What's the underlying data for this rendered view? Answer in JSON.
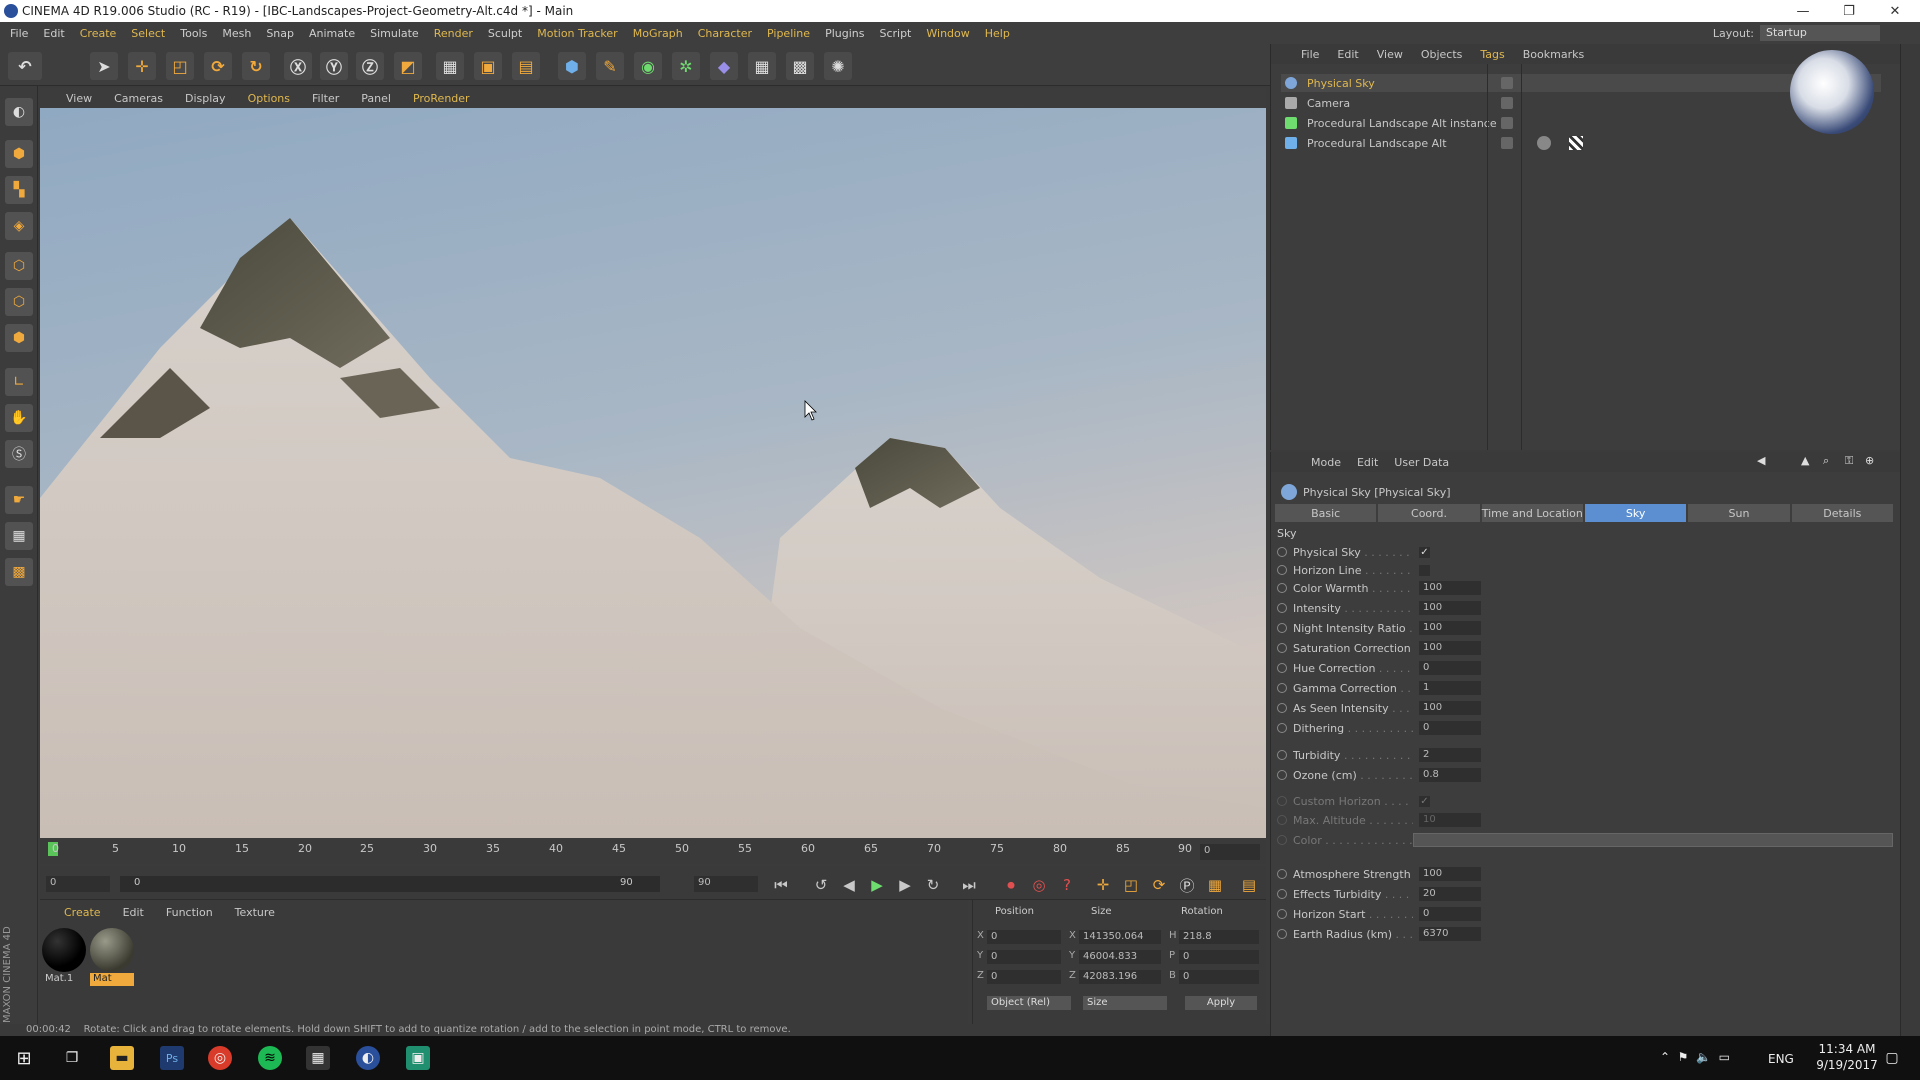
{
  "window": {
    "title": "CINEMA 4D R19.006 Studio (RC - R19) - [IBC-Landscapes-Project-Geometry-Alt.c4d *] - Main",
    "controls": {
      "minimize": "—",
      "maximize": "❐",
      "close": "✕"
    }
  },
  "menu": [
    "File",
    "Edit",
    "Create",
    "Select",
    "Tools",
    "Mesh",
    "Snap",
    "Animate",
    "Simulate",
    "Render",
    "Sculpt",
    "Motion Tracker",
    "MoGraph",
    "Character",
    "Pipeline",
    "Plugins",
    "Script",
    "Window",
    "Help"
  ],
  "layout": {
    "label": "Layout:",
    "value": "Startup"
  },
  "viewport_menu": [
    "View",
    "Cameras",
    "Display",
    "Options",
    "Filter",
    "Panel",
    "ProRender"
  ],
  "timeline": {
    "ticks": [
      "0",
      "5",
      "10",
      "15",
      "20",
      "25",
      "30",
      "35",
      "40",
      "45",
      "50",
      "55",
      "60",
      "65",
      "70",
      "75",
      "80",
      "85",
      "90"
    ],
    "current": "0",
    "start": "0",
    "range_start": "0",
    "range_end": "90",
    "end": "90"
  },
  "material_menu": [
    "Create",
    "Edit",
    "Function",
    "Texture"
  ],
  "materials": [
    {
      "name": "Mat.1",
      "selected": false
    },
    {
      "name": "Mat",
      "selected": true
    }
  ],
  "coords": {
    "headers": {
      "position": "Position",
      "size": "Size",
      "rotation": "Rotation"
    },
    "rows": [
      {
        "axis": "X",
        "pos": "0",
        "size_axis": "X",
        "size": "141350.064",
        "rot_axis": "H",
        "rot": "218.8"
      },
      {
        "axis": "Y",
        "pos": "0",
        "size_axis": "Y",
        "size": "46004.833",
        "rot_axis": "P",
        "rot": "0"
      },
      {
        "axis": "Z",
        "pos": "0",
        "size_axis": "Z",
        "size": "42083.196",
        "rot_axis": "B",
        "rot": "0"
      }
    ],
    "mode": "Object (Rel)",
    "size_mode": "Size",
    "apply": "Apply"
  },
  "status": {
    "time": "00:00:42",
    "message": "Rotate: Click and drag to rotate elements. Hold down SHIFT to add to quantize rotation / add to the selection in point mode, CTRL to remove."
  },
  "objects_menu": [
    "File",
    "Edit",
    "View",
    "Objects",
    "Tags",
    "Bookmarks"
  ],
  "objects": [
    {
      "name": "Physical Sky",
      "selected": true
    },
    {
      "name": "Camera",
      "selected": false
    },
    {
      "name": "Procedural Landscape Alt instance",
      "selected": false
    },
    {
      "name": "Procedural Landscape Alt",
      "selected": false
    }
  ],
  "attributes_menu": [
    "Mode",
    "Edit",
    "User Data"
  ],
  "attributes_title": "Physical Sky [Physical Sky]",
  "tabs": [
    "Basic",
    "Coord.",
    "Time and Location",
    "Sky",
    "Sun",
    "Details"
  ],
  "active_tab": "Sky",
  "section": "Sky",
  "params": [
    {
      "label": "Physical Sky",
      "type": "check",
      "value": "✓"
    },
    {
      "label": "Horizon Line",
      "type": "check",
      "value": ""
    },
    {
      "label": "Color Warmth",
      "type": "num",
      "value": "100"
    },
    {
      "label": "Intensity",
      "type": "num",
      "value": "100"
    },
    {
      "label": "Night Intensity Ratio",
      "type": "num",
      "value": "100"
    },
    {
      "label": "Saturation Correction",
      "type": "num",
      "value": "100"
    },
    {
      "label": "Hue Correction",
      "type": "num",
      "value": "0"
    },
    {
      "label": "Gamma Correction",
      "type": "num",
      "value": "1"
    },
    {
      "label": "As Seen Intensity",
      "type": "num",
      "value": "100"
    },
    {
      "label": "Dithering",
      "type": "num",
      "value": "0"
    },
    {
      "label": "Turbidity",
      "type": "num",
      "value": "2"
    },
    {
      "label": "Ozone (cm)",
      "type": "num",
      "value": "0.8"
    },
    {
      "label": "Custom Horizon",
      "type": "check",
      "value": "✓",
      "disabled": true
    },
    {
      "label": "Max. Altitude",
      "type": "num",
      "value": "10",
      "disabled": true
    },
    {
      "label": "Color",
      "type": "gradient",
      "value": "",
      "disabled": true
    },
    {
      "label": "Atmosphere Strength",
      "type": "num",
      "value": "100"
    },
    {
      "label": "Effects Turbidity",
      "type": "num",
      "value": "20"
    },
    {
      "label": "Horizon Start",
      "type": "num",
      "value": "0"
    },
    {
      "label": "Earth Radius (km)",
      "type": "num",
      "value": "6370"
    }
  ],
  "taskbar": {
    "lang": "ENG",
    "time": "11:34 AM",
    "date": "9/19/2017"
  },
  "maxon": {
    "brand": "MAXON",
    "product": "CINEMA 4D"
  }
}
